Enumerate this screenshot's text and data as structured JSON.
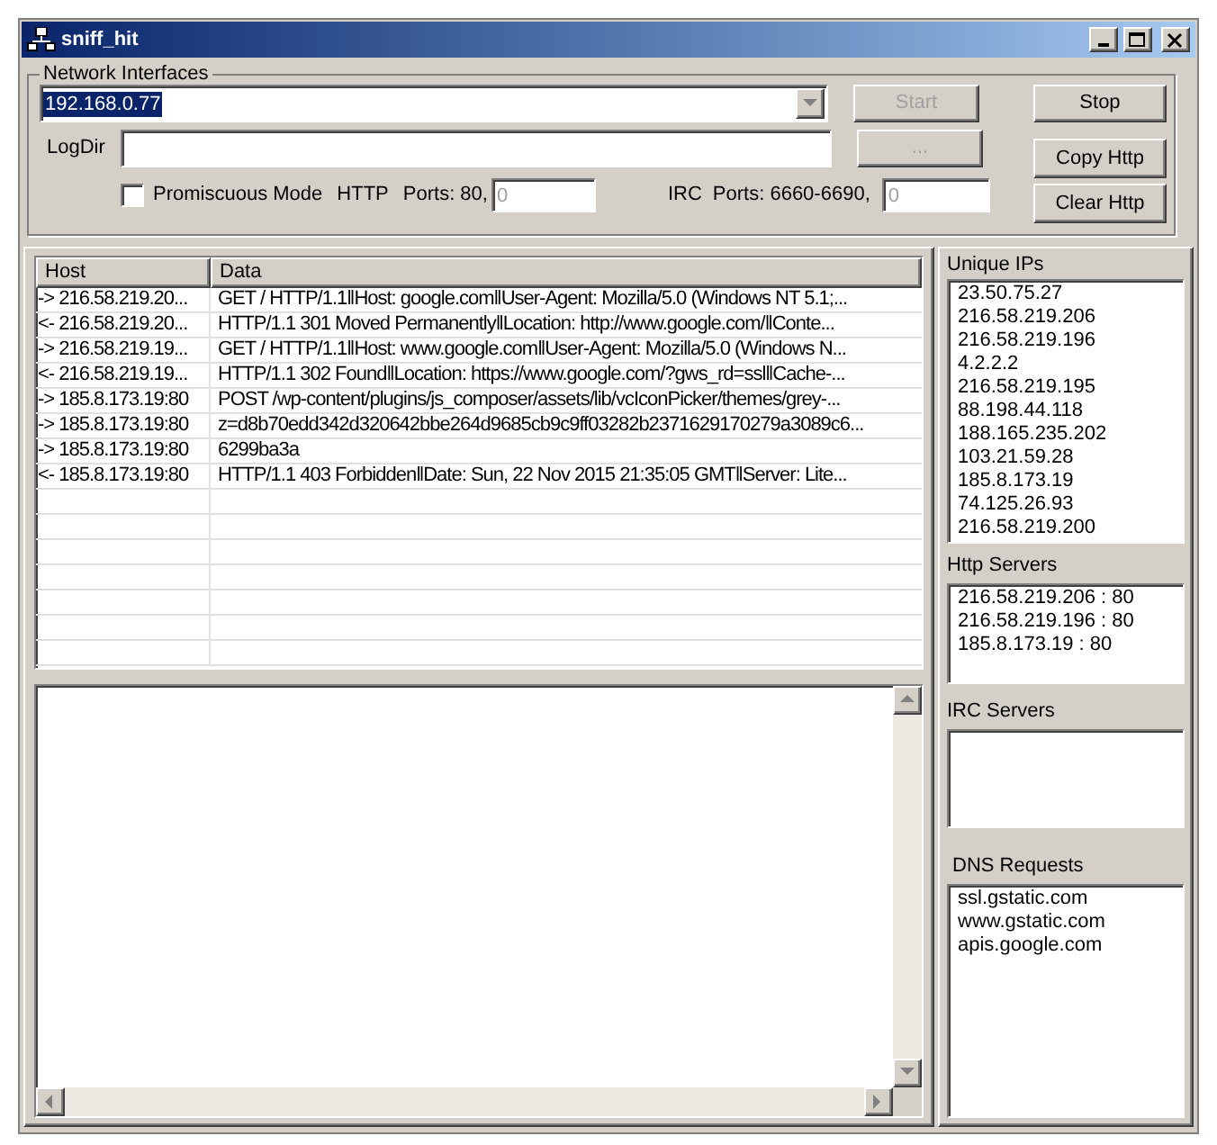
{
  "window": {
    "title": "sniff_hit"
  },
  "network_interfaces": {
    "label": "Network Interfaces",
    "interface": "192.168.0.77",
    "logdir_label": "LogDir",
    "start_button": {
      "label": "Start",
      "disabled": true
    },
    "browse_button": {
      "label": "...",
      "disabled": true
    },
    "promiscuous": {
      "label": "Promiscuous Mode",
      "checked": false
    },
    "http_label": "HTTP",
    "http_ports_label": "Ports: 80,",
    "http_ports_value": "0",
    "irc_label": "IRC",
    "irc_ports_label": "Ports: 6660-6690,",
    "irc_ports_value": "0"
  },
  "buttons": [
    {
      "label": "Stop"
    },
    {
      "label": "Copy Http"
    },
    {
      "label": "Clear Http"
    }
  ],
  "table": {
    "columns": [
      "Host",
      "Data"
    ],
    "rows": [
      {
        "host": "-> 216.58.219.20...",
        "data": "GET / HTTP/1.1‖Host: google.com‖User-Agent: Mozilla/5.0 (Windows NT 5.1;..."
      },
      {
        "host": "<- 216.58.219.20...",
        "data": "HTTP/1.1 301 Moved Permanently‖Location: http://www.google.com/‖Conte..."
      },
      {
        "host": "-> 216.58.219.19...",
        "data": "GET / HTTP/1.1‖Host: www.google.com‖User-Agent: Mozilla/5.0 (Windows N..."
      },
      {
        "host": "<- 216.58.219.19...",
        "data": "HTTP/1.1 302 Found‖Location: https://www.google.com/?gws_rd=ssl‖Cache-..."
      },
      {
        "host": "-> 185.8.173.19:80",
        "data": "POST /wp-content/plugins/js_composer/assets/lib/vcIconPicker/themes/grey-..."
      },
      {
        "host": "-> 185.8.173.19:80",
        "data": "z=d8b70edd342d320642bbe264d9685cb9c9ff03282b2371629170279a3089c6..."
      },
      {
        "host": "-> 185.8.173.19:80",
        "data": "6299ba3a"
      },
      {
        "host": "<- 185.8.173.19:80",
        "data": "HTTP/1.1 403 Forbidden‖Date: Sun, 22 Nov 2015 21:35:05 GMT‖Server: Lite..."
      }
    ]
  },
  "unique_ips": {
    "label": "Unique IPs",
    "items": [
      "23.50.75.27",
      "216.58.219.206",
      "216.58.219.196",
      "4.2.2.2",
      "216.58.219.195",
      "88.198.44.118",
      "188.165.235.202",
      "103.21.59.28",
      "185.8.173.19",
      "74.125.26.93",
      "216.58.219.200"
    ]
  },
  "http_servers": {
    "label": "Http Servers",
    "items": [
      "216.58.219.206 : 80",
      "216.58.219.196 : 80",
      "185.8.173.19 : 80"
    ]
  },
  "irc_servers": {
    "label": "IRC Servers"
  },
  "dns_requests": {
    "label": "DNS Requests",
    "items": [
      "ssl.gstatic.com",
      "www.gstatic.com",
      "apis.google.com"
    ]
  }
}
